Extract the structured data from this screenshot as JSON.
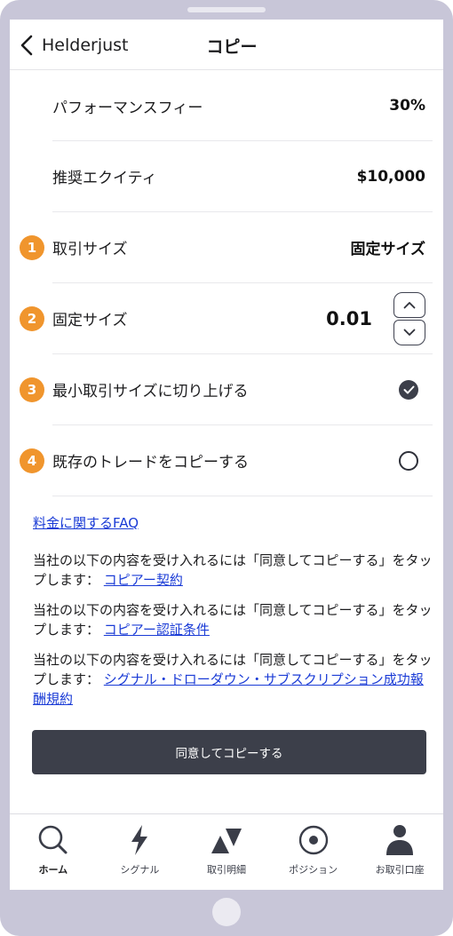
{
  "header": {
    "back_label": "Helderjust",
    "title": "コピー"
  },
  "settings": {
    "performance_fee_label": "パフォーマンスフィー",
    "performance_fee_value": "30%",
    "recommended_equity_label": "推奨エクイティ",
    "recommended_equity_value": "$10,000",
    "trade_size_badge": "1",
    "trade_size_label": "取引サイズ",
    "trade_size_value": "固定サイズ",
    "fixed_size_badge": "2",
    "fixed_size_label": "固定サイズ",
    "fixed_size_value": "0.01",
    "round_up_badge": "3",
    "round_up_label": "最小取引サイズに切り上げる",
    "round_up_checked": true,
    "copy_existing_badge": "4",
    "copy_existing_label": "既存のトレードをコピーする",
    "copy_existing_checked": false
  },
  "links": {
    "faq": "料金に関するFAQ"
  },
  "terms": [
    {
      "text": "当社の以下の内容を受け入れるには「同意してコピーする」をタップします：",
      "link": "コピアー契約"
    },
    {
      "text": "当社の以下の内容を受け入れるには「同意してコピーする」をタップします：",
      "link": "コピアー認証条件"
    },
    {
      "text": "当社の以下の内容を受け入れるには「同意してコピーする」をタップします：",
      "link": "シグナル・ドローダウン・サブスクリプション成功報酬規約"
    }
  ],
  "agree_button": "同意してコピーする",
  "nav": [
    {
      "label": "ホーム",
      "icon": "search-icon"
    },
    {
      "label": "シグナル",
      "icon": "lightning-icon"
    },
    {
      "label": "取引明細",
      "icon": "up-down-triangles-icon"
    },
    {
      "label": "ポジション",
      "icon": "target-circle-icon"
    },
    {
      "label": "お取引口座",
      "icon": "person-icon"
    }
  ],
  "colors": {
    "badge": "#f0952d",
    "link": "#1a3bd6",
    "primary_button": "#3c3f4a",
    "frame": "#c8c6d8"
  }
}
